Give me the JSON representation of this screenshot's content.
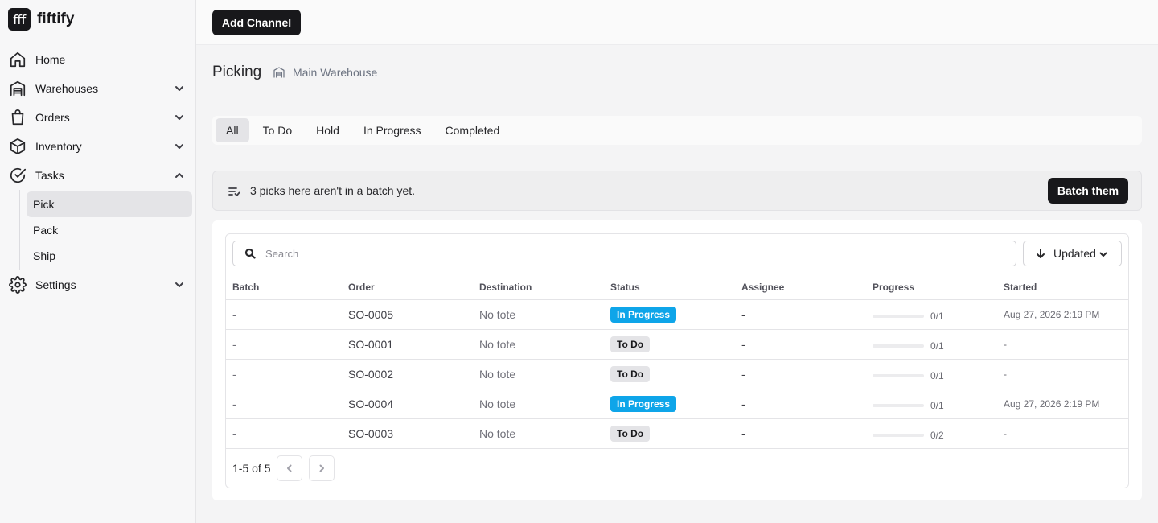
{
  "brand": {
    "logo_text": "fff",
    "name": "fiftify"
  },
  "sidebar": {
    "items": [
      {
        "label": "Home",
        "icon": "home-icon"
      },
      {
        "label": "Warehouses",
        "icon": "warehouse-icon"
      },
      {
        "label": "Orders",
        "icon": "shopping-bag-icon"
      },
      {
        "label": "Inventory",
        "icon": "box-icon"
      },
      {
        "label": "Tasks",
        "icon": "check-circle-icon"
      },
      {
        "label": "Settings",
        "icon": "gear-icon"
      }
    ],
    "task_subitems": [
      {
        "label": "Pick",
        "active": true
      },
      {
        "label": "Pack",
        "active": false
      },
      {
        "label": "Ship",
        "active": false
      }
    ]
  },
  "topbar": {
    "add_channel_label": "Add Channel"
  },
  "header": {
    "title": "Picking",
    "warehouse": "Main Warehouse"
  },
  "tabs": [
    {
      "label": "All",
      "active": true
    },
    {
      "label": "To Do",
      "active": false
    },
    {
      "label": "Hold",
      "active": false
    },
    {
      "label": "In Progress",
      "active": false
    },
    {
      "label": "Completed",
      "active": false
    }
  ],
  "banner": {
    "text": "3 picks here aren't in a batch yet.",
    "button_label": "Batch them"
  },
  "search": {
    "placeholder": "Search",
    "value": ""
  },
  "sort": {
    "label": "Updated"
  },
  "table": {
    "columns": [
      "Batch",
      "Order",
      "Destination",
      "Status",
      "Assignee",
      "Progress",
      "Started"
    ],
    "rows": [
      {
        "batch": "-",
        "order": "SO-0005",
        "destination": "No tote",
        "status": "In Progress",
        "assignee": "-",
        "progress": "0/1",
        "progress_fraction": 0,
        "started": "Aug 27, 2026 2:19 PM"
      },
      {
        "batch": "-",
        "order": "SO-0001",
        "destination": "No tote",
        "status": "To Do",
        "assignee": "-",
        "progress": "0/1",
        "progress_fraction": 0,
        "started": "-"
      },
      {
        "batch": "-",
        "order": "SO-0002",
        "destination": "No tote",
        "status": "To Do",
        "assignee": "-",
        "progress": "0/1",
        "progress_fraction": 0,
        "started": "-"
      },
      {
        "batch": "-",
        "order": "SO-0004",
        "destination": "No tote",
        "status": "In Progress",
        "assignee": "-",
        "progress": "0/1",
        "progress_fraction": 0,
        "started": "Aug 27, 2026 2:19 PM"
      },
      {
        "batch": "-",
        "order": "SO-0003",
        "destination": "No tote",
        "status": "To Do",
        "assignee": "-",
        "progress": "0/2",
        "progress_fraction": 0,
        "started": "-"
      }
    ]
  },
  "pagination": {
    "text": "1-5 of 5"
  },
  "colors": {
    "in_progress": "#0ea5e9",
    "primary_dark": "#18181b",
    "todo_badge": "#e4e4e7"
  }
}
